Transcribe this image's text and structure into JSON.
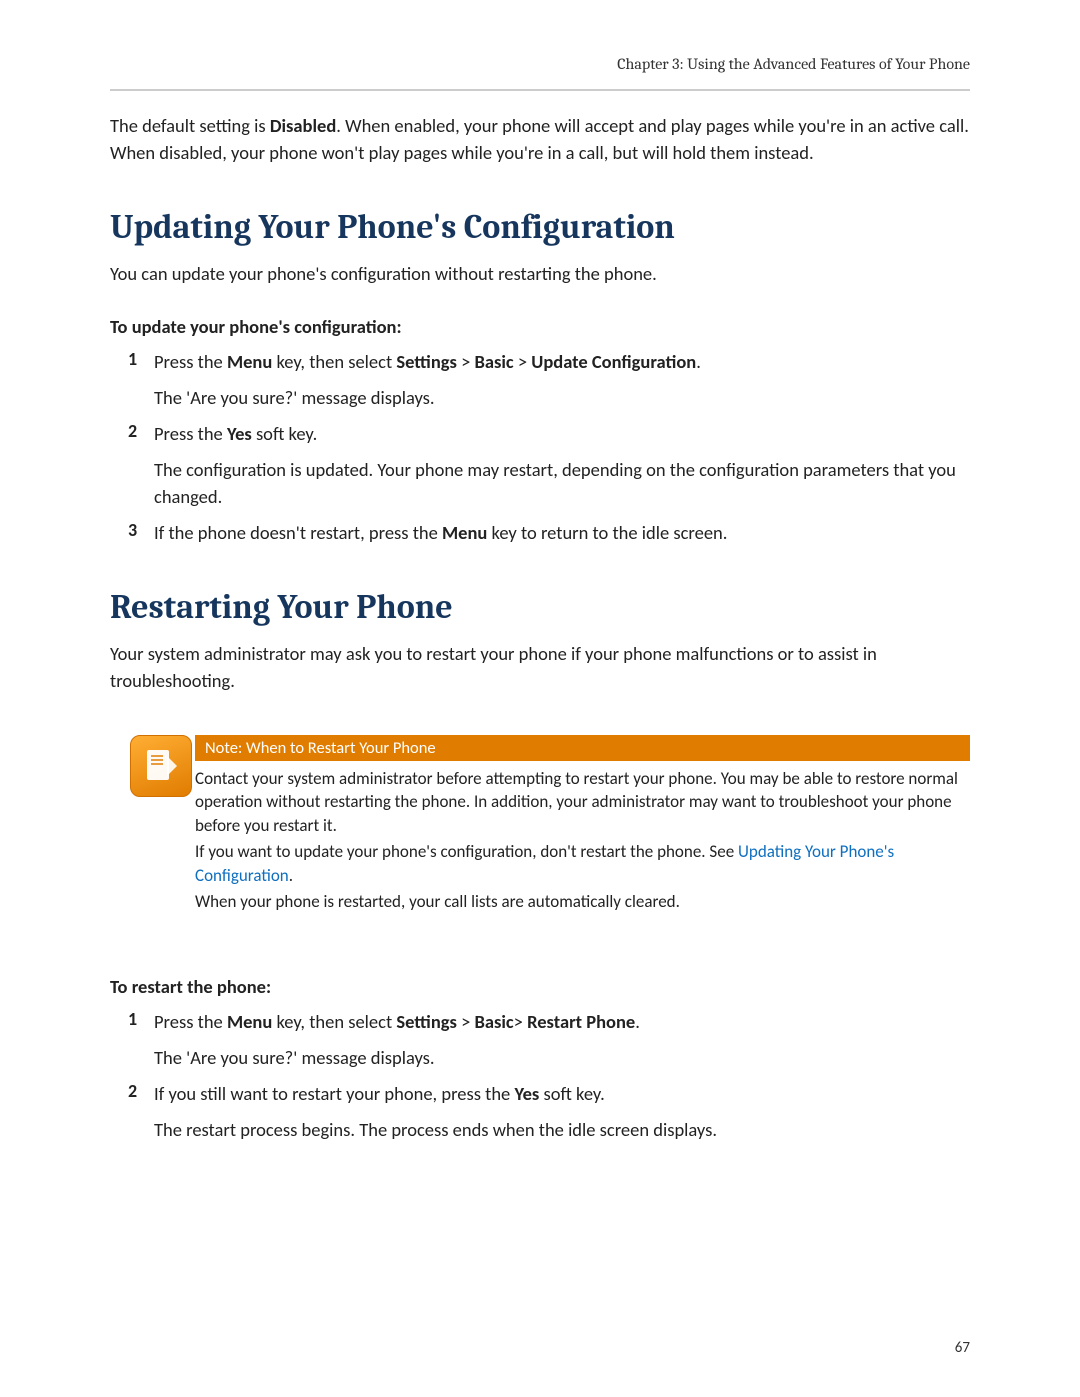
{
  "header": {
    "chapter": "Chapter 3: Using the Advanced Features of Your Phone"
  },
  "intro": {
    "prefix": "The default setting is ",
    "bold": "Disabled",
    "suffix": ". When enabled, your phone will accept and play pages while you're in an active call. When disabled, your phone won't play pages while you're in a call, but will hold them instead."
  },
  "sec1": {
    "title": "Updating Your Phone's Configuration",
    "lead": "You can update your phone's configuration without restarting the phone.",
    "proc_head": "To update your phone's configuration:",
    "steps": {
      "s1": {
        "num": "1",
        "l1_a": "Press the ",
        "l1_b": "Menu",
        "l1_c": " key, then select ",
        "l1_d": "Settings",
        "l1_e": " > ",
        "l1_f": "Basic",
        "l1_g": " > ",
        "l1_h": "Update Configuration",
        "l1_i": ".",
        "l2": "The 'Are you sure?' message displays."
      },
      "s2": {
        "num": "2",
        "l1_a": "Press the ",
        "l1_b": "Yes",
        "l1_c": " soft key.",
        "l2": "The configuration is updated. Your phone may restart, depending on the configuration parameters that you changed."
      },
      "s3": {
        "num": "3",
        "l1_a": "If the phone doesn't restart, press the ",
        "l1_b": "Menu",
        "l1_c": " key to return to the idle screen."
      }
    }
  },
  "sec2": {
    "title": "Restarting Your Phone",
    "lead": "Your system administrator may ask you to restart your phone if your phone malfunctions or to assist in troubleshooting.",
    "note": {
      "title": "Note: When to Restart Your Phone",
      "p1": "Contact your system administrator before attempting to restart your phone. You may be able to restore normal operation without restarting the phone. In addition, your administrator may want to troubleshoot your phone before you restart it.",
      "p2_a": "If you want to update your phone's configuration, don't restart the phone. See ",
      "p2_link": "Updating Your Phone's Configuration",
      "p2_b": ".",
      "p3": "When your phone is restarted, your call lists are automatically cleared."
    },
    "proc_head": "To restart the phone:",
    "steps": {
      "s1": {
        "num": "1",
        "l1_a": " Press the ",
        "l1_b": "Menu",
        "l1_c": " key, then select ",
        "l1_d": "Settings",
        "l1_e": " > ",
        "l1_f": "Basic",
        "l1_g": "> ",
        "l1_h": "Restart Phone",
        "l1_i": ".",
        "l2": "The 'Are you sure?' message displays."
      },
      "s2": {
        "num": "2",
        "l1_a": "If you still want to restart your phone, press the ",
        "l1_b": "Yes",
        "l1_c": " soft key.",
        "l2": "The restart process begins. The process ends when the idle screen displays."
      }
    }
  },
  "page_number": "67"
}
